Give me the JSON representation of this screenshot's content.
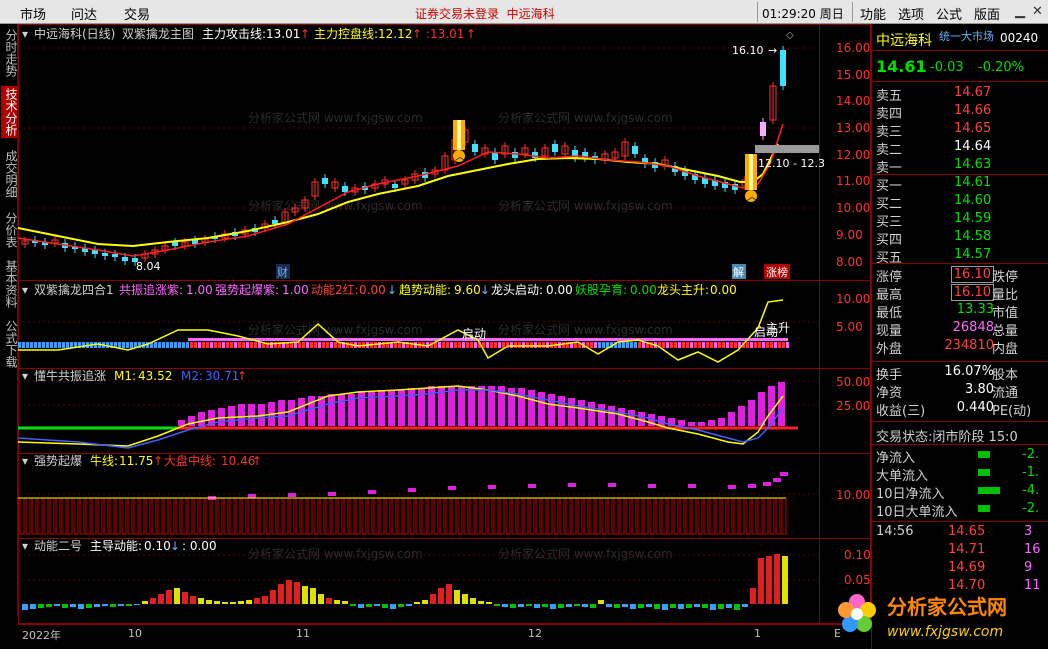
{
  "topbar": {
    "menu": [
      "市场",
      "问达",
      "交易"
    ],
    "notice": "证券交易未登录",
    "stock_name": "中远海科",
    "clock": "01:29:20 周日",
    "right_menu": [
      "功能",
      "选项",
      "公式",
      "版面"
    ]
  },
  "left_tabs": [
    {
      "label": "分时走势",
      "active": false
    },
    {
      "label": "技术分析",
      "active": true
    },
    {
      "label": "成交明细",
      "active": false
    },
    {
      "label": "分价表",
      "active": false
    },
    {
      "label": "基本资料",
      "active": false
    },
    {
      "label": "公式下载",
      "active": false
    }
  ],
  "panels": {
    "main": {
      "stock": "中远海科(日线)",
      "indicator": "双紫擒龙主图",
      "line1_name": "主力攻击线:",
      "line1_val": "13.01",
      "line2_name": "主力控盘线:",
      "line2_val": "12.12",
      "line3_val": ":13.01",
      "y_ticks": [
        "16.00",
        "15.00",
        "14.00",
        "13.00",
        "12.00",
        "11.00",
        "10.00",
        "9.00",
        "8.00"
      ],
      "high_label": "16.10",
      "low_label": "8.04",
      "range_label": "12.10 - 12.3",
      "tags": [
        "财",
        "解",
        "涨榜"
      ],
      "colors": {
        "up": "#ff3030",
        "down": "#40e0ff",
        "line_yellow": "#ffff00",
        "line_red": "#ff2020"
      }
    },
    "p2": {
      "name": "双紫擒龙四合1",
      "items": [
        {
          "label": "共振追涨紫:",
          "val": "1.00",
          "color": "#ff66ff"
        },
        {
          "label": "强势起爆紫:",
          "val": "1.00",
          "color": "#ff66ff"
        },
        {
          "label": "动能2红:",
          "val": "0.00",
          "color": "#ff4040"
        },
        {
          "label": "趋势动能:",
          "val": "9.60",
          "color": "#ffff00"
        },
        {
          "label": "龙头启动:",
          "val": "0.00",
          "color": "#ffffff"
        },
        {
          "label": "妖股孕育:",
          "val": "0.00",
          "color": "#00e000"
        },
        {
          "label": "龙头主升:",
          "val": "0.00",
          "color": "#ffff00"
        }
      ],
      "y_ticks": [
        "10.00",
        "5.00"
      ],
      "annotations": [
        "启动",
        "启动",
        "主升"
      ]
    },
    "p3": {
      "name": "懂牛共振追涨",
      "m1_label": "M1:",
      "m1_val": "43.52",
      "m2_label": "M2:",
      "m2_val": "30.71",
      "y_ticks": [
        "50.00",
        "25.00"
      ]
    },
    "p4": {
      "name": "强势起爆",
      "l1_label": "牛线:",
      "l1_val": "11.75",
      "l2_label": "大盘中线:",
      "l2_val": "10.46",
      "y_ticks": [
        "10.00"
      ]
    },
    "p5": {
      "name": "动能二号",
      "l1_label": "主导动能:",
      "l1_val": "0.10",
      "l2_val": ": 0.00",
      "y_ticks": [
        "0.10",
        "0.05"
      ]
    }
  },
  "x_axis": {
    "labels": [
      "2022年",
      "10",
      "11",
      "12",
      "1"
    ],
    "end_mark": "E"
  },
  "right_panel": {
    "name": "中远海科",
    "tag": "统一大市场",
    "code": "00240",
    "price": "14.61",
    "change": "-0.03",
    "pct": "-0.20%",
    "asks": [
      {
        "label": "卖五",
        "price": "14.67"
      },
      {
        "label": "卖四",
        "price": "14.66"
      },
      {
        "label": "卖三",
        "price": "14.65"
      },
      {
        "label": "卖二",
        "price": "14.64"
      },
      {
        "label": "卖一",
        "price": "14.63"
      }
    ],
    "bids": [
      {
        "label": "买一",
        "price": "14.61"
      },
      {
        "label": "买二",
        "price": "14.60"
      },
      {
        "label": "买三",
        "price": "14.59"
      },
      {
        "label": "买四",
        "price": "14.58"
      },
      {
        "label": "买五",
        "price": "14.57"
      }
    ],
    "stats": [
      {
        "l1": "涨停",
        "v1": "16.10",
        "l2": "跌停"
      },
      {
        "l1": "最高",
        "v1": "16.10",
        "l2": "量比"
      },
      {
        "l1": "最低",
        "v1": "13.33",
        "l2": "市值"
      },
      {
        "l1": "现量",
        "v1": "26848",
        "l2": "总量"
      },
      {
        "l1": "外盘",
        "v1": "234810",
        "l2": "内盘"
      }
    ],
    "stats2": [
      {
        "l1": "换手",
        "v1": "16.07%",
        "l2": "股本"
      },
      {
        "l1": "净资",
        "v1": "3.80",
        "l2": "流通"
      },
      {
        "l1": "收益(三)",
        "v1": "0.440",
        "l2": "PE(动)"
      }
    ],
    "trade_status_label": "交易状态:",
    "trade_status": "闭市阶段",
    "trade_status_time": "15:0",
    "flows": [
      {
        "label": "净流入",
        "val": "-2."
      },
      {
        "label": "大单流入",
        "val": "-1."
      },
      {
        "label": "10日净流入",
        "val": "-4."
      },
      {
        "label": "10日大单流入",
        "val": "-2."
      }
    ],
    "ticks": [
      {
        "time": "14:56",
        "price": "14.65",
        "vol": "3"
      },
      {
        "time": "",
        "price": "14.71",
        "vol": "16"
      },
      {
        "time": "",
        "price": "14.69",
        "vol": "9"
      },
      {
        "time": "",
        "price": "14.70",
        "vol": "11"
      }
    ]
  },
  "watermark": {
    "title": "分析家公式网",
    "url": "www.fxjgsw.com"
  }
}
